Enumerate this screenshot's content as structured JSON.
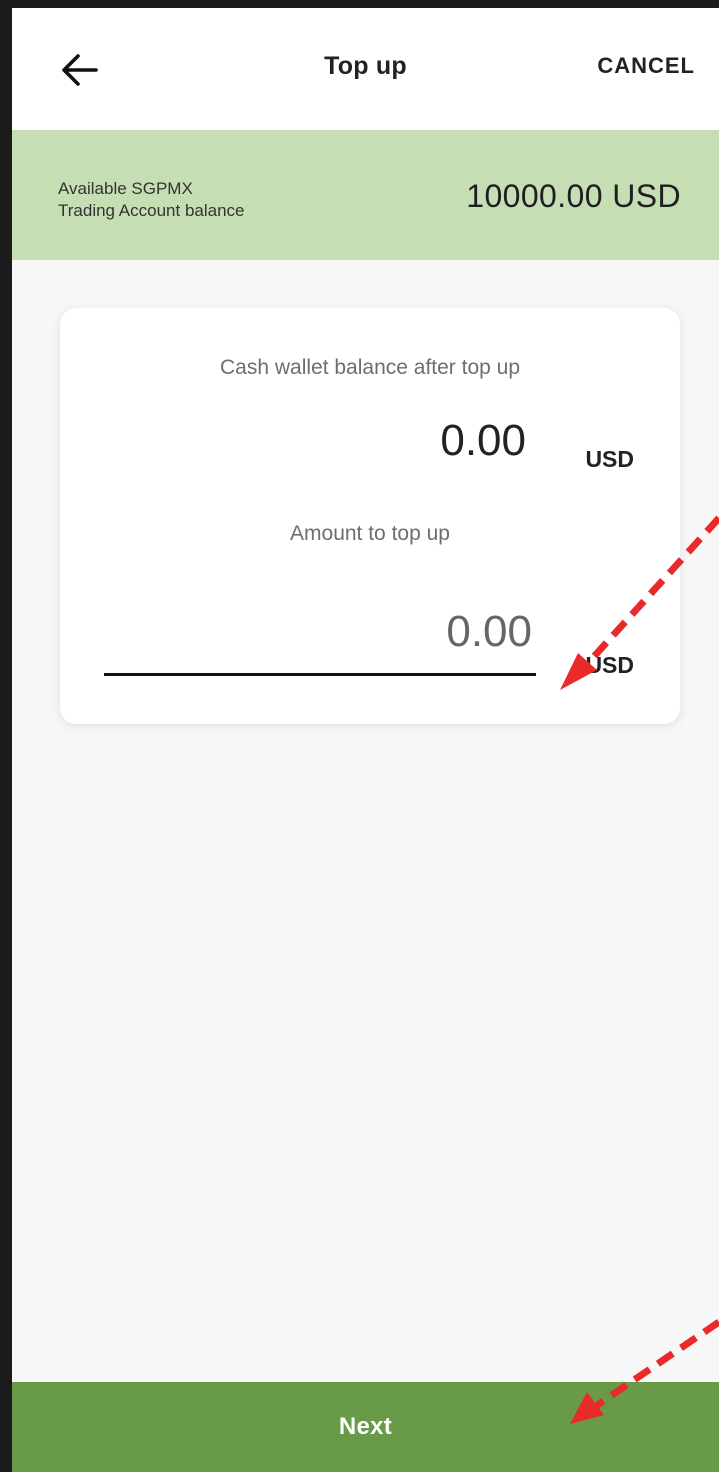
{
  "header": {
    "back_icon": "arrow-left-icon",
    "title": "Top up",
    "cancel_label": "CANCEL"
  },
  "balance_bar": {
    "label_line1": "Available SGPMX",
    "label_line2": "Trading Account balance",
    "value": "10000.00 USD"
  },
  "card": {
    "cash_wallet_label": "Cash wallet balance after top up",
    "cash_wallet_amount": "0.00",
    "cash_wallet_currency": "USD",
    "amount_label": "Amount to top up",
    "amount_input_value": "0.00",
    "amount_currency": "USD"
  },
  "footer": {
    "next_label": "Next"
  },
  "colors": {
    "balance_bar_bg": "#c6deb4",
    "next_button_bg": "#689a48",
    "annotation_arrow": "#e82a2a"
  }
}
